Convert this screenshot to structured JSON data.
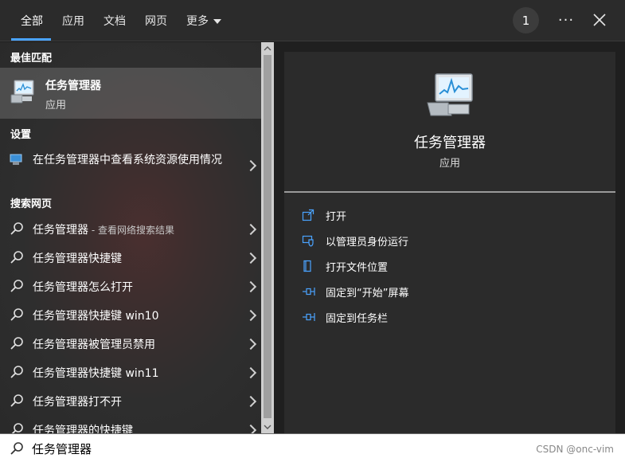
{
  "tabs": [
    {
      "label": "全部"
    },
    {
      "label": "应用"
    },
    {
      "label": "文档"
    },
    {
      "label": "网页"
    },
    {
      "label": "更多"
    }
  ],
  "header": {
    "count_badge": "1",
    "more_label": "···"
  },
  "best_match": {
    "section_title": "最佳匹配",
    "title": "任务管理器",
    "subtitle": "应用"
  },
  "settings": {
    "section_title": "设置",
    "item_label": "在任务管理器中查看系统资源使用情况"
  },
  "web": {
    "section_title": "搜索网页",
    "items": [
      {
        "label": "任务管理器",
        "hint": " - 查看网络搜索结果"
      },
      {
        "label": "任务管理器快捷键",
        "hint": ""
      },
      {
        "label": "任务管理器怎么打开",
        "hint": ""
      },
      {
        "label": "任务管理器快捷键 win10",
        "hint": ""
      },
      {
        "label": "任务管理器被管理员禁用",
        "hint": ""
      },
      {
        "label": "任务管理器快捷键 win11",
        "hint": ""
      },
      {
        "label": "任务管理器打不开",
        "hint": ""
      },
      {
        "label": "任务管理器的快捷键",
        "hint": ""
      }
    ]
  },
  "detail": {
    "title": "任务管理器",
    "subtitle": "应用",
    "actions": [
      {
        "label": "打开"
      },
      {
        "label": "以管理员身份运行"
      },
      {
        "label": "打开文件位置"
      },
      {
        "label": "固定到“开始”屏幕"
      },
      {
        "label": "固定到任务栏"
      }
    ]
  },
  "search": {
    "value": "任务管理器"
  },
  "watermark": "CSDN @onc-vim",
  "colors": {
    "accent": "#4aa3ff",
    "panel": "#2b2b2b",
    "background": "#1f1f1f"
  }
}
